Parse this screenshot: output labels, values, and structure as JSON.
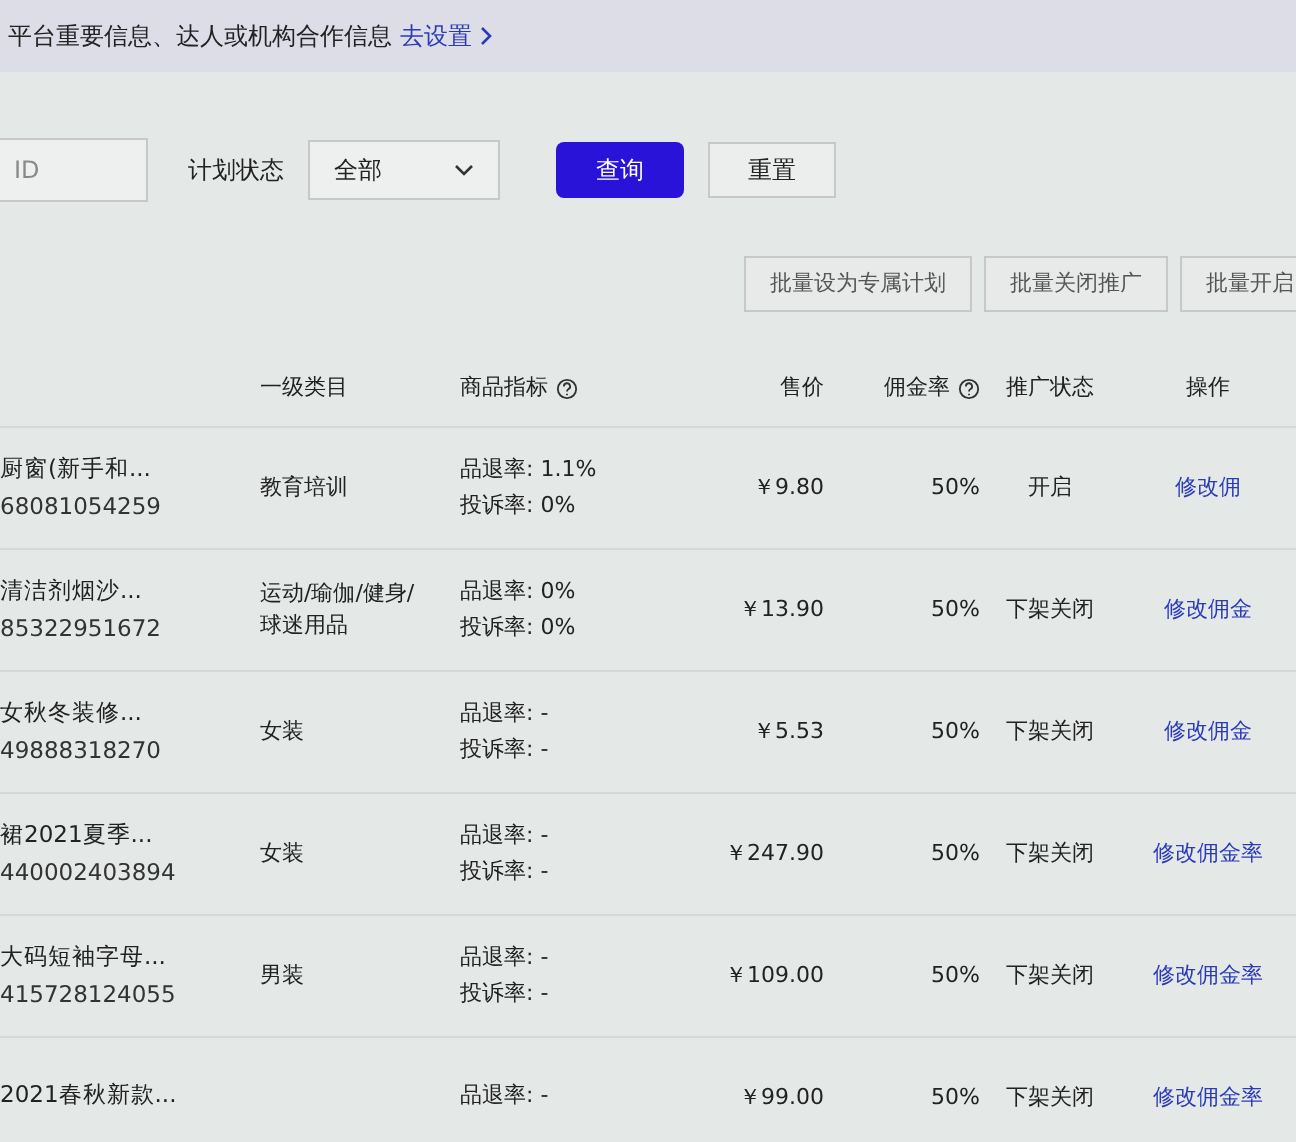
{
  "notice": {
    "text": "平台重要信息、达人或机构合作信息",
    "link": "去设置"
  },
  "filters": {
    "id_field": {
      "placeholder": "ID"
    },
    "status_label": "计划状态",
    "status_value": "全部",
    "query_button": "查询",
    "reset_button": "重置"
  },
  "batch_buttons": [
    "批量设为专属计划",
    "批量关闭推广",
    "批量开启"
  ],
  "table": {
    "columns": [
      {
        "label": "一级类目",
        "help": false
      },
      {
        "label": "商品指标",
        "help": true
      },
      {
        "label": "售价",
        "help": false
      },
      {
        "label": "佣金率",
        "help": true
      },
      {
        "label": "推广状态",
        "help": false
      },
      {
        "label": "操作",
        "help": false
      }
    ],
    "rows": [
      {
        "name": "厨窗(新手和...",
        "id": "68081054259",
        "category": "教育培训",
        "return_rate": "品退率: 1.1%",
        "complaint_rate": "投诉率: 0%",
        "price": "￥9.80",
        "commission": "50%",
        "status": "开启",
        "action": "修改佣"
      },
      {
        "name": "清洁剂烟沙...",
        "id": "85322951672",
        "category": "运动/瑜伽/健身/球迷用品",
        "return_rate": "品退率: 0%",
        "complaint_rate": "投诉率: 0%",
        "price": "￥13.90",
        "commission": "50%",
        "status": "下架关闭",
        "action": "修改佣金"
      },
      {
        "name": "女秋冬装修...",
        "id": "49888318270",
        "category": "女装",
        "return_rate": "品退率: -",
        "complaint_rate": "投诉率: -",
        "price": "￥5.53",
        "commission": "50%",
        "status": "下架关闭",
        "action": "修改佣金"
      },
      {
        "name": "裙2021夏季...",
        "id": "440002403894",
        "category": "女装",
        "return_rate": "品退率: -",
        "complaint_rate": "投诉率: -",
        "price": "￥247.90",
        "commission": "50%",
        "status": "下架关闭",
        "action": "修改佣金率"
      },
      {
        "name": "大码短袖字母...",
        "id": "415728124055",
        "category": "男装",
        "return_rate": "品退率: -",
        "complaint_rate": "投诉率: -",
        "price": "￥109.00",
        "commission": "50%",
        "status": "下架关闭",
        "action": "修改佣金率"
      },
      {
        "name": "2021春秋新款...",
        "id": "",
        "category": "",
        "return_rate": "品退率: -",
        "complaint_rate": "",
        "price": "￥99.00",
        "commission": "50%",
        "status": "下架关闭",
        "action": "修改佣金率"
      }
    ]
  }
}
